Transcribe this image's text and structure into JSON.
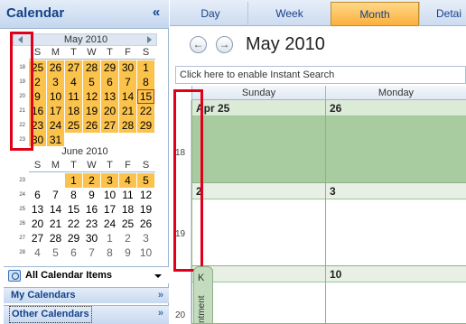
{
  "nav": {
    "title": "Calendar",
    "collapse_glyph": "«",
    "mini_may": {
      "title": "May 2010",
      "dow": [
        "S",
        "M",
        "T",
        "W",
        "T",
        "F",
        "S"
      ],
      "weeks": [
        {
          "wk": "18",
          "days": [
            "25",
            "26",
            "27",
            "28",
            "29",
            "30",
            "1"
          ]
        },
        {
          "wk": "19",
          "days": [
            "2",
            "3",
            "4",
            "5",
            "6",
            "7",
            "8"
          ]
        },
        {
          "wk": "20",
          "days": [
            "9",
            "10",
            "11",
            "12",
            "13",
            "14",
            "15"
          ]
        },
        {
          "wk": "21",
          "days": [
            "16",
            "17",
            "18",
            "19",
            "20",
            "21",
            "22"
          ]
        },
        {
          "wk": "22",
          "days": [
            "23",
            "24",
            "25",
            "26",
            "27",
            "28",
            "29"
          ]
        },
        {
          "wk": "23",
          "days": [
            "30",
            "31",
            "",
            "",
            "",
            "",
            ""
          ]
        }
      ]
    },
    "mini_june": {
      "title": "June 2010",
      "dow": [
        "S",
        "M",
        "T",
        "W",
        "T",
        "F",
        "S"
      ],
      "weeks": [
        {
          "wk": "23",
          "days": [
            "",
            "",
            "1",
            "2",
            "3",
            "4",
            "5"
          ]
        },
        {
          "wk": "24",
          "days": [
            "6",
            "7",
            "8",
            "9",
            "10",
            "11",
            "12"
          ]
        },
        {
          "wk": "25",
          "days": [
            "13",
            "14",
            "15",
            "16",
            "17",
            "18",
            "19"
          ]
        },
        {
          "wk": "26",
          "days": [
            "20",
            "21",
            "22",
            "23",
            "24",
            "25",
            "26"
          ]
        },
        {
          "wk": "27",
          "days": [
            "27",
            "28",
            "29",
            "30",
            "1",
            "2",
            "3"
          ]
        },
        {
          "wk": "28",
          "days": [
            "4",
            "5",
            "6",
            "7",
            "8",
            "9",
            "10"
          ]
        }
      ]
    },
    "all_items": "All Calendar Items",
    "my_calendars": "My Calendars",
    "other_calendars": "Other Calendars",
    "chevron": "»"
  },
  "main": {
    "tabs": [
      "Day",
      "Week",
      "Month",
      "Detai"
    ],
    "active_tab": "Month",
    "prev_glyph": "←",
    "next_glyph": "→",
    "month_title": "May 2010",
    "search_placeholder": "Click here to enable Instant Search",
    "dow_headers": [
      "Sunday",
      "Monday"
    ],
    "week_numbers": [
      "18",
      "19",
      "20"
    ],
    "week1": {
      "sun": "Apr 25",
      "mon": "26"
    },
    "week2": {
      "sun": "2",
      "mon": "3"
    },
    "week3": {
      "sun": "",
      "mon": "10"
    },
    "gripper_text": "ntment",
    "gripper_arrow": "K"
  },
  "colors": {
    "highlight": "#fbc24c",
    "selected_week": "#a8cc9f",
    "annotation_red": "#e0001a",
    "accent": "#15428b"
  },
  "icons": [
    "calendar-items-icon",
    "left-arrow-icon",
    "right-arrow-icon",
    "chevron-down-icon"
  ]
}
